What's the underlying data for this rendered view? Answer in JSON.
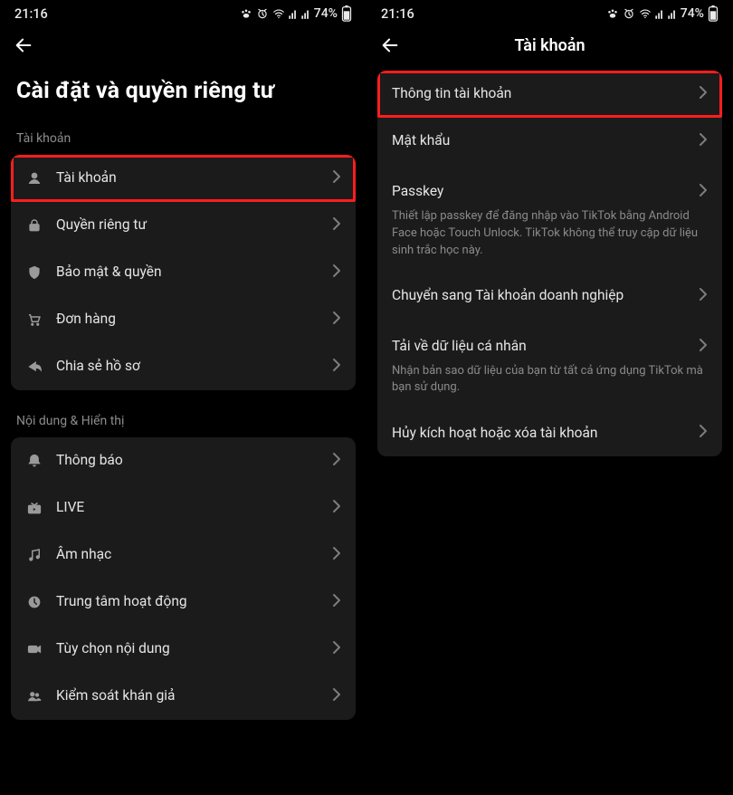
{
  "status": {
    "time": "21:16",
    "battery_text": "74%"
  },
  "left": {
    "heading": "Cài đặt và quyền riêng tư",
    "sections": {
      "account": {
        "label": "Tài khoản",
        "items": {
          "account": {
            "label": "Tài khoản"
          },
          "privacy": {
            "label": "Quyền riêng tư"
          },
          "security": {
            "label": "Bảo mật & quyền"
          },
          "orders": {
            "label": "Đơn hàng"
          },
          "share": {
            "label": "Chia sẻ hồ sơ"
          }
        }
      },
      "content": {
        "label": "Nội dung & Hiển thị",
        "items": {
          "notifications": {
            "label": "Thông báo"
          },
          "live": {
            "label": "LIVE"
          },
          "music": {
            "label": "Âm nhạc"
          },
          "activity": {
            "label": "Trung tâm hoạt động"
          },
          "prefs": {
            "label": "Tùy chọn nội dung"
          },
          "audience": {
            "label": "Kiểm soát khán giả"
          }
        }
      }
    }
  },
  "right": {
    "title": "Tài khoản",
    "items": {
      "info": {
        "label": "Thông tin tài khoản"
      },
      "password": {
        "label": "Mật khẩu"
      },
      "passkey": {
        "label": "Passkey",
        "desc": "Thiết lập passkey để đăng nhập vào TikTok bằng Android Face hoặc Touch Unlock. TikTok không thể truy cập dữ liệu sinh trắc học này."
      },
      "business": {
        "label": "Chuyển sang Tài khoản doanh nghiệp"
      },
      "download": {
        "label": "Tải về dữ liệu cá nhân",
        "desc": "Nhận bản sao dữ liệu của bạn từ tất cả ứng dụng TikTok mà bạn sử dụng."
      },
      "deactivate": {
        "label": "Hủy kích hoạt hoặc xóa tài khoản"
      }
    }
  }
}
